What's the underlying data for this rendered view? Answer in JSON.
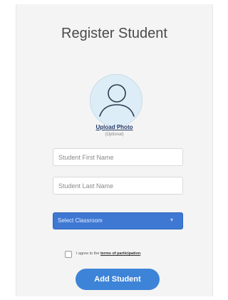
{
  "form": {
    "title": "Register Student",
    "upload_label": "Upload Photo",
    "optional_label": "(Optional)",
    "first_name_placeholder": "Student First Name",
    "last_name_placeholder": "Student Last Name",
    "classroom_select": {
      "selected": "Select Classroom",
      "chevron_icon": "chevron-down-icon"
    },
    "agree": {
      "prefix": "I agree to the",
      "link": "terms of participation",
      "suffix": "."
    },
    "submit_label": "Add Student"
  },
  "colors": {
    "card_bg": "#f4f4f4",
    "avatar_bg": "#dcedf7",
    "avatar_stroke": "#2f3b4f",
    "select_bg": "#3e78d3",
    "button_bg": "#3d84d8"
  }
}
